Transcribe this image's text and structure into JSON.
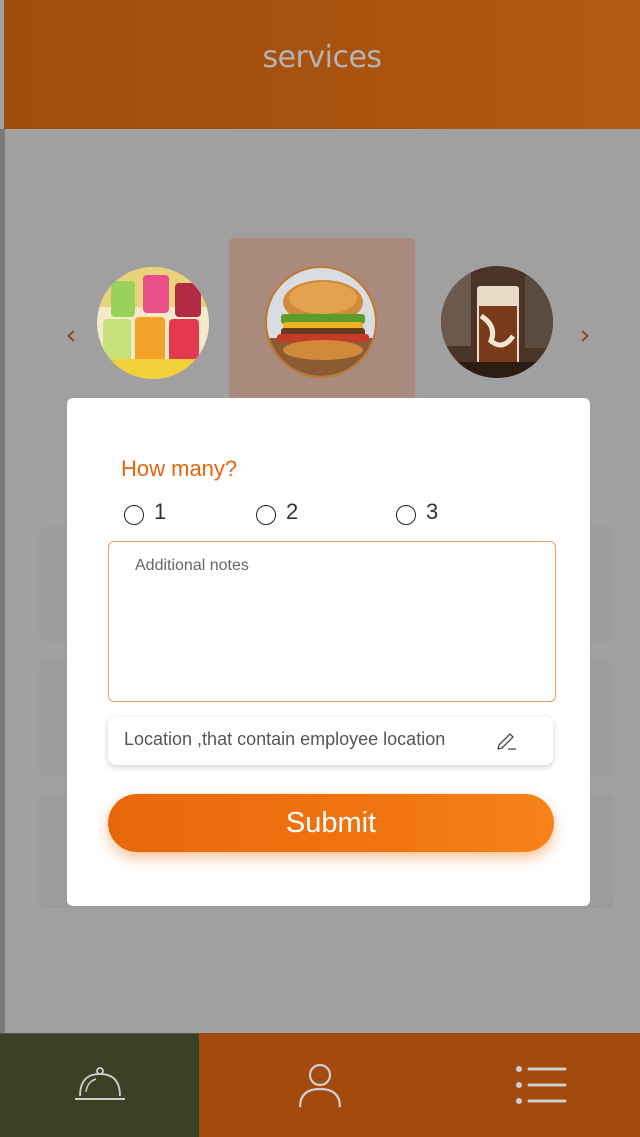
{
  "header": {
    "title": "services"
  },
  "carousel": {
    "prev_icon": "chevron-left-icon",
    "next_icon": "chevron-right-icon",
    "prev_glyph": "‹",
    "next_glyph": "›",
    "items": [
      {
        "image": "smoothies"
      },
      {
        "image": "burger",
        "selected": true
      },
      {
        "image": "iced-coffee"
      }
    ]
  },
  "modal": {
    "question": "How many?",
    "options": [
      "1",
      "2",
      "3"
    ],
    "notes_placeholder": "Additional notes",
    "location_text": "Location ,that contain employee location",
    "location_icon": "pencil-icon",
    "submit_label": "Submit"
  },
  "bottom_nav": {
    "items": [
      {
        "icon": "cloche-icon",
        "active": true
      },
      {
        "icon": "user-icon",
        "active": false
      },
      {
        "icon": "list-icon",
        "active": false
      }
    ]
  },
  "colors": {
    "accent": "#e8650e",
    "header": "#a9530f",
    "nav_active": "#3b4125",
    "nav_bg": "#a34a0f"
  }
}
